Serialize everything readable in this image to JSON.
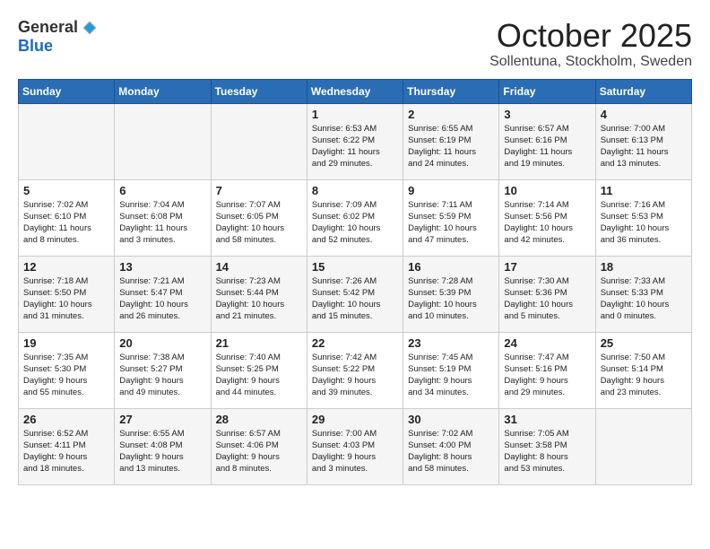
{
  "header": {
    "logo_general": "General",
    "logo_blue": "Blue",
    "title": "October 2025",
    "location": "Sollentuna, Stockholm, Sweden"
  },
  "calendar": {
    "days_of_week": [
      "Sunday",
      "Monday",
      "Tuesday",
      "Wednesday",
      "Thursday",
      "Friday",
      "Saturday"
    ],
    "weeks": [
      [
        {
          "day": "",
          "info": ""
        },
        {
          "day": "",
          "info": ""
        },
        {
          "day": "",
          "info": ""
        },
        {
          "day": "1",
          "info": "Sunrise: 6:53 AM\nSunset: 6:22 PM\nDaylight: 11 hours\nand 29 minutes."
        },
        {
          "day": "2",
          "info": "Sunrise: 6:55 AM\nSunset: 6:19 PM\nDaylight: 11 hours\nand 24 minutes."
        },
        {
          "day": "3",
          "info": "Sunrise: 6:57 AM\nSunset: 6:16 PM\nDaylight: 11 hours\nand 19 minutes."
        },
        {
          "day": "4",
          "info": "Sunrise: 7:00 AM\nSunset: 6:13 PM\nDaylight: 11 hours\nand 13 minutes."
        }
      ],
      [
        {
          "day": "5",
          "info": "Sunrise: 7:02 AM\nSunset: 6:10 PM\nDaylight: 11 hours\nand 8 minutes."
        },
        {
          "day": "6",
          "info": "Sunrise: 7:04 AM\nSunset: 6:08 PM\nDaylight: 11 hours\nand 3 minutes."
        },
        {
          "day": "7",
          "info": "Sunrise: 7:07 AM\nSunset: 6:05 PM\nDaylight: 10 hours\nand 58 minutes."
        },
        {
          "day": "8",
          "info": "Sunrise: 7:09 AM\nSunset: 6:02 PM\nDaylight: 10 hours\nand 52 minutes."
        },
        {
          "day": "9",
          "info": "Sunrise: 7:11 AM\nSunset: 5:59 PM\nDaylight: 10 hours\nand 47 minutes."
        },
        {
          "day": "10",
          "info": "Sunrise: 7:14 AM\nSunset: 5:56 PM\nDaylight: 10 hours\nand 42 minutes."
        },
        {
          "day": "11",
          "info": "Sunrise: 7:16 AM\nSunset: 5:53 PM\nDaylight: 10 hours\nand 36 minutes."
        }
      ],
      [
        {
          "day": "12",
          "info": "Sunrise: 7:18 AM\nSunset: 5:50 PM\nDaylight: 10 hours\nand 31 minutes."
        },
        {
          "day": "13",
          "info": "Sunrise: 7:21 AM\nSunset: 5:47 PM\nDaylight: 10 hours\nand 26 minutes."
        },
        {
          "day": "14",
          "info": "Sunrise: 7:23 AM\nSunset: 5:44 PM\nDaylight: 10 hours\nand 21 minutes."
        },
        {
          "day": "15",
          "info": "Sunrise: 7:26 AM\nSunset: 5:42 PM\nDaylight: 10 hours\nand 15 minutes."
        },
        {
          "day": "16",
          "info": "Sunrise: 7:28 AM\nSunset: 5:39 PM\nDaylight: 10 hours\nand 10 minutes."
        },
        {
          "day": "17",
          "info": "Sunrise: 7:30 AM\nSunset: 5:36 PM\nDaylight: 10 hours\nand 5 minutes."
        },
        {
          "day": "18",
          "info": "Sunrise: 7:33 AM\nSunset: 5:33 PM\nDaylight: 10 hours\nand 0 minutes."
        }
      ],
      [
        {
          "day": "19",
          "info": "Sunrise: 7:35 AM\nSunset: 5:30 PM\nDaylight: 9 hours\nand 55 minutes."
        },
        {
          "day": "20",
          "info": "Sunrise: 7:38 AM\nSunset: 5:27 PM\nDaylight: 9 hours\nand 49 minutes."
        },
        {
          "day": "21",
          "info": "Sunrise: 7:40 AM\nSunset: 5:25 PM\nDaylight: 9 hours\nand 44 minutes."
        },
        {
          "day": "22",
          "info": "Sunrise: 7:42 AM\nSunset: 5:22 PM\nDaylight: 9 hours\nand 39 minutes."
        },
        {
          "day": "23",
          "info": "Sunrise: 7:45 AM\nSunset: 5:19 PM\nDaylight: 9 hours\nand 34 minutes."
        },
        {
          "day": "24",
          "info": "Sunrise: 7:47 AM\nSunset: 5:16 PM\nDaylight: 9 hours\nand 29 minutes."
        },
        {
          "day": "25",
          "info": "Sunrise: 7:50 AM\nSunset: 5:14 PM\nDaylight: 9 hours\nand 23 minutes."
        }
      ],
      [
        {
          "day": "26",
          "info": "Sunrise: 6:52 AM\nSunset: 4:11 PM\nDaylight: 9 hours\nand 18 minutes."
        },
        {
          "day": "27",
          "info": "Sunrise: 6:55 AM\nSunset: 4:08 PM\nDaylight: 9 hours\nand 13 minutes."
        },
        {
          "day": "28",
          "info": "Sunrise: 6:57 AM\nSunset: 4:06 PM\nDaylight: 9 hours\nand 8 minutes."
        },
        {
          "day": "29",
          "info": "Sunrise: 7:00 AM\nSunset: 4:03 PM\nDaylight: 9 hours\nand 3 minutes."
        },
        {
          "day": "30",
          "info": "Sunrise: 7:02 AM\nSunset: 4:00 PM\nDaylight: 8 hours\nand 58 minutes."
        },
        {
          "day": "31",
          "info": "Sunrise: 7:05 AM\nSunset: 3:58 PM\nDaylight: 8 hours\nand 53 minutes."
        },
        {
          "day": "",
          "info": ""
        }
      ]
    ]
  }
}
